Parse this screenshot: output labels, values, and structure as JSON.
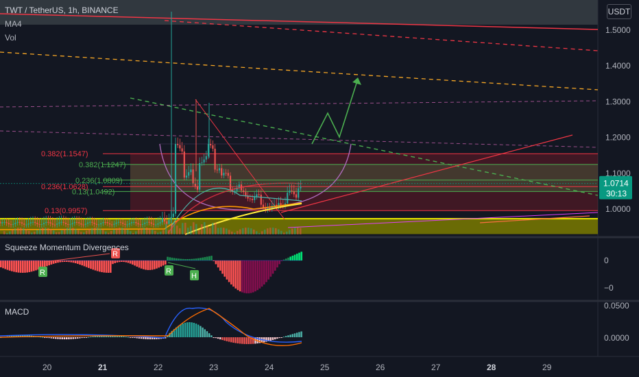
{
  "header": {
    "symbol": "TWT / TetherUS, 1h, BINANCE",
    "indicator_1": "MA4",
    "indicator_2": "Vol"
  },
  "currency_badge": "USDT",
  "price_pane": {
    "y_ticks": [
      "1.5000",
      "1.4000",
      "1.3000",
      "1.2000",
      "1.1000",
      "1.0000"
    ],
    "current_price": "1.0714",
    "countdown": "30:13",
    "fib_levels": [
      {
        "label": "0.382(1.1547)",
        "color": "#f23645"
      },
      {
        "label": "0.382(1.1247)",
        "color": "#4caf50"
      },
      {
        "label": "0.236(1.0809)",
        "color": "#4caf50"
      },
      {
        "label": "0.236(1.0628)",
        "color": "#f23645"
      },
      {
        "label": "0.13(1.0492)",
        "color": "#4caf50"
      },
      {
        "label": "0.13(0.9957)",
        "color": "#f23645"
      }
    ]
  },
  "squeeze_pane": {
    "title": "Squeeze Momentum Divergences",
    "y_ticks": [
      "0",
      "−0"
    ],
    "markers": [
      "R",
      "R",
      "R",
      "H"
    ]
  },
  "macd_pane": {
    "title": "MACD",
    "y_ticks": [
      "0.0500",
      "0.0000"
    ]
  },
  "x_axis": {
    "ticks": [
      "20",
      "21",
      "22",
      "23",
      "24",
      "25",
      "26",
      "27",
      "28",
      "29"
    ],
    "bold": [
      "21",
      "28"
    ]
  },
  "chart_data": {
    "type": "candlestick",
    "title": "TWT / TetherUS, 1h, BINANCE",
    "xlabel": "",
    "ylabel": "",
    "x_range": [
      "20",
      "29"
    ],
    "ylim": [
      0.93,
      1.55
    ],
    "grid": false,
    "price_annotations": [
      1.1547,
      1.1247,
      1.0809,
      1.0628,
      1.0492,
      0.9957
    ],
    "last_price": 1.0714,
    "close_approx": [
      [
        22.0,
        0.97
      ],
      [
        22.2,
        0.98
      ],
      [
        22.3,
        1.17
      ],
      [
        22.45,
        1.1
      ],
      [
        22.6,
        1.06
      ],
      [
        22.75,
        1.14
      ],
      [
        22.9,
        1.17
      ],
      [
        23.0,
        1.12
      ],
      [
        23.15,
        1.09
      ],
      [
        23.3,
        1.06
      ],
      [
        23.5,
        1.04
      ],
      [
        23.7,
        1.03
      ],
      [
        23.85,
        1.01
      ],
      [
        24.0,
        1.0
      ],
      [
        24.15,
        1.02
      ],
      [
        24.3,
        1.04
      ],
      [
        24.5,
        1.07
      ]
    ]
  }
}
